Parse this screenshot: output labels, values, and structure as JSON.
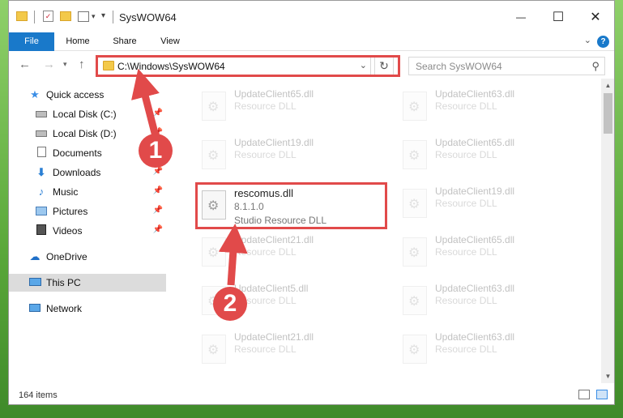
{
  "window": {
    "title": "SysWOW64",
    "controls": {
      "minimize": "—",
      "maximize": "☐",
      "close": "✕"
    }
  },
  "ribbon": {
    "tabs": [
      "File",
      "Home",
      "Share",
      "View"
    ],
    "help": "?"
  },
  "nav": {
    "address": "C:\\Windows\\SysWOW64",
    "search_placeholder": "Search SysWOW64"
  },
  "sidebar": {
    "items": [
      {
        "label": "Quick access",
        "icon": "star-icon"
      },
      {
        "label": "Local Disk (C:)",
        "icon": "drive-icon"
      },
      {
        "label": "Local Disk (D:)",
        "icon": "drive-icon"
      },
      {
        "label": "Documents",
        "icon": "documents-icon"
      },
      {
        "label": "Downloads",
        "icon": "downloads-icon"
      },
      {
        "label": "Music",
        "icon": "music-icon"
      },
      {
        "label": "Pictures",
        "icon": "pictures-icon"
      },
      {
        "label": "Videos",
        "icon": "videos-icon"
      },
      {
        "label": "OneDrive",
        "icon": "cloud-icon"
      },
      {
        "label": "This PC",
        "icon": "computer-icon"
      },
      {
        "label": "Network",
        "icon": "network-icon"
      }
    ]
  },
  "files": [
    {
      "name": "UpdateClient65.dll",
      "type": "Resource DLL"
    },
    {
      "name": "UpdateClient63.dll",
      "type": "Resource DLL"
    },
    {
      "name": "UpdateClient19.dll",
      "type": "Resource DLL"
    },
    {
      "name": "UpdateClient65.dll",
      "type": "Resource DLL"
    },
    {
      "name": "rescomus.dll",
      "version": "8.1.1.0",
      "type": "Studio Resource DLL"
    },
    {
      "name": "UpdateClient19.dll",
      "type": "Resource DLL"
    },
    {
      "name": "UpdateClient21.dll",
      "type": "Resource DLL"
    },
    {
      "name": "UpdateClient65.dll",
      "type": "Resource DLL"
    },
    {
      "name": "UpdateClient5.dll",
      "type": "Resource DLL"
    },
    {
      "name": "UpdateClient63.dll",
      "type": "Resource DLL"
    },
    {
      "name": "UpdateClient21.dll",
      "type": "Resource DLL"
    },
    {
      "name": "UpdateClient63.dll",
      "type": "Resource DLL"
    }
  ],
  "status": {
    "item_count": "164 items"
  },
  "annotations": {
    "step1": "1",
    "step2": "2",
    "color": "#e14a4a"
  }
}
